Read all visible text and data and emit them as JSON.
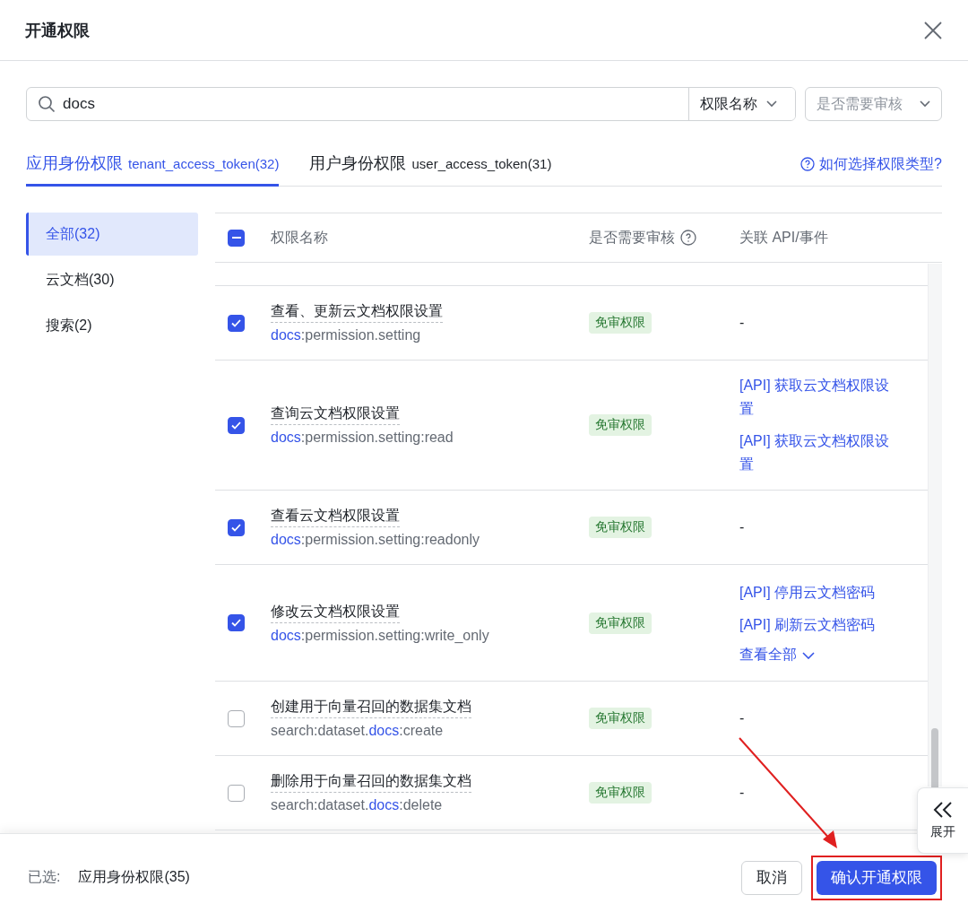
{
  "window": {
    "title": "开通权限"
  },
  "search": {
    "value": "docs",
    "field_select": "权限名称",
    "review_filter": {
      "placeholder": "是否需要审核"
    }
  },
  "tabs": [
    {
      "label": "应用身份权限",
      "token": "tenant_access_token(32)",
      "selected": true
    },
    {
      "label": "用户身份权限",
      "token": "user_access_token(31)",
      "selected": false
    }
  ],
  "help_link": "如何选择权限类型?",
  "sidebar": {
    "items": [
      {
        "label": "全部(32)",
        "selected": true
      },
      {
        "label": "云文档(30)",
        "selected": false
      },
      {
        "label": "搜索(2)",
        "selected": false
      }
    ]
  },
  "table": {
    "select_all": {
      "indeterminate": true
    },
    "columns": [
      "权限名称",
      "是否需要审核",
      "关联 API/事件"
    ],
    "rows": [
      {
        "name": "查看、更新云文档权限设置",
        "code": "**docs**:permission.setting",
        "checked": true,
        "review": "免审权限",
        "apis": [],
        "empty": "-"
      },
      {
        "name": "查询云文档权限设置",
        "code": "**docs**:permission.setting:read",
        "checked": true,
        "review": "免审权限",
        "apis": [
          "[API] 获取云文档权限设置",
          "[API] 获取云文档权限设置"
        ]
      },
      {
        "name": "查看云文档权限设置",
        "code": "**docs**:permission.setting:readonly",
        "checked": true,
        "review": "免审权限",
        "apis": [],
        "empty": "-"
      },
      {
        "name": "修改云文档权限设置",
        "code": "**docs**:permission.setting:write_only",
        "checked": true,
        "review": "免审权限",
        "apis": [
          "[API] 停用云文档密码",
          "[API] 刷新云文档密码"
        ],
        "more": "查看全部"
      },
      {
        "name": "创建用于向量召回的数据集文档",
        "code": "search:dataset.**docs**:create",
        "checked": false,
        "review": "免审权限",
        "apis": [],
        "empty": "-"
      },
      {
        "name": "删除用于向量召回的数据集文档",
        "code": "search:dataset.**docs**:delete",
        "checked": false,
        "review": "免审权限",
        "apis": [],
        "empty": "-"
      }
    ]
  },
  "expand_tab": {
    "label": "展开"
  },
  "footer": {
    "selected_label": "已选:",
    "selected_value": "应用身份权限(35)",
    "buttons": [
      {
        "label": "取消",
        "kind": "secondary"
      },
      {
        "label": "确认开通权限",
        "kind": "primary",
        "highlighted": true
      }
    ]
  }
}
